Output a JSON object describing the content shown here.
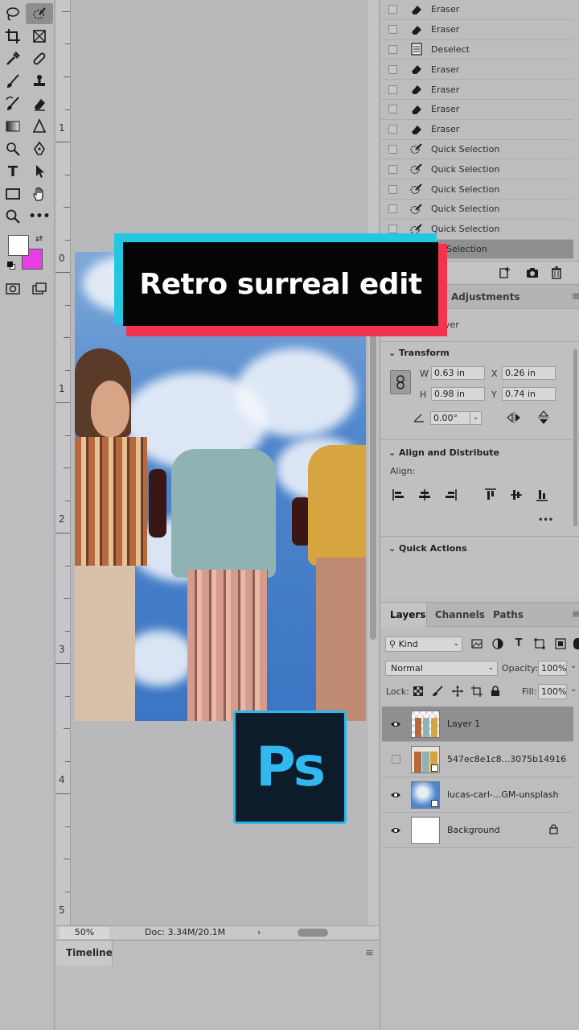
{
  "overlay": {
    "title": "Retro surreal edit",
    "logo_text": "Ps"
  },
  "rulers": {
    "vertical": [
      "1",
      "0",
      "1",
      "2",
      "3",
      "4",
      "5"
    ]
  },
  "status": {
    "zoom": "50%",
    "doc": "Doc: 3.34M/20.1M",
    "arrow": "›"
  },
  "timeline": {
    "tab": "Timeline"
  },
  "history": {
    "items": [
      {
        "label": "Eraser",
        "icon": "eraser-icon"
      },
      {
        "label": "Eraser",
        "icon": "eraser-icon"
      },
      {
        "label": "Deselect",
        "icon": "document-icon"
      },
      {
        "label": "Eraser",
        "icon": "eraser-icon"
      },
      {
        "label": "Eraser",
        "icon": "eraser-icon"
      },
      {
        "label": "Eraser",
        "icon": "eraser-icon"
      },
      {
        "label": "Eraser",
        "icon": "eraser-icon"
      },
      {
        "label": "Quick Selection",
        "icon": "quick-selection-icon"
      },
      {
        "label": "Quick Selection",
        "icon": "quick-selection-icon"
      },
      {
        "label": "Quick Selection",
        "icon": "quick-selection-icon"
      },
      {
        "label": "Quick Selection",
        "icon": "quick-selection-icon"
      },
      {
        "label": "Quick Selection",
        "icon": "quick-selection-icon"
      },
      {
        "label": "ick Selection",
        "icon": "quick-selection-icon"
      }
    ]
  },
  "properties": {
    "tab_adjustments": "Adjustments",
    "partial_label": "yer",
    "transform": {
      "title": "Transform",
      "w_label": "W",
      "w": "0.63 in",
      "x_label": "X",
      "x": "0.26 in",
      "h_label": "H",
      "h": "0.98 in",
      "y_label": "Y",
      "y": "0.74 in",
      "angle": "0.00°"
    },
    "align": {
      "title": "Align and Distribute",
      "label": "Align:",
      "more": "•••"
    },
    "quick_actions": {
      "title": "Quick Actions"
    }
  },
  "layers_panel": {
    "tabs": [
      "Layers",
      "Channels",
      "Paths"
    ],
    "filter": "Kind",
    "blend_mode": "Normal",
    "opacity_label": "Opacity:",
    "opacity": "100%",
    "lock_label": "Lock:",
    "fill_label": "Fill:",
    "fill": "100%",
    "layers": [
      {
        "name": "Layer 1",
        "visible": true,
        "selected": true
      },
      {
        "name": "547ec8e1c8...3075b14916",
        "visible": false,
        "selected": false
      },
      {
        "name": "lucas-carl-...GM-unsplash",
        "visible": true,
        "selected": false
      },
      {
        "name": "Background",
        "visible": true,
        "selected": false
      }
    ]
  },
  "colors": {
    "foreground": "#ffffff",
    "background": "#e63fe6",
    "title_cyan": "#23c7e2",
    "title_red": "#f3344f",
    "ps_blue": "#31b8f0"
  }
}
